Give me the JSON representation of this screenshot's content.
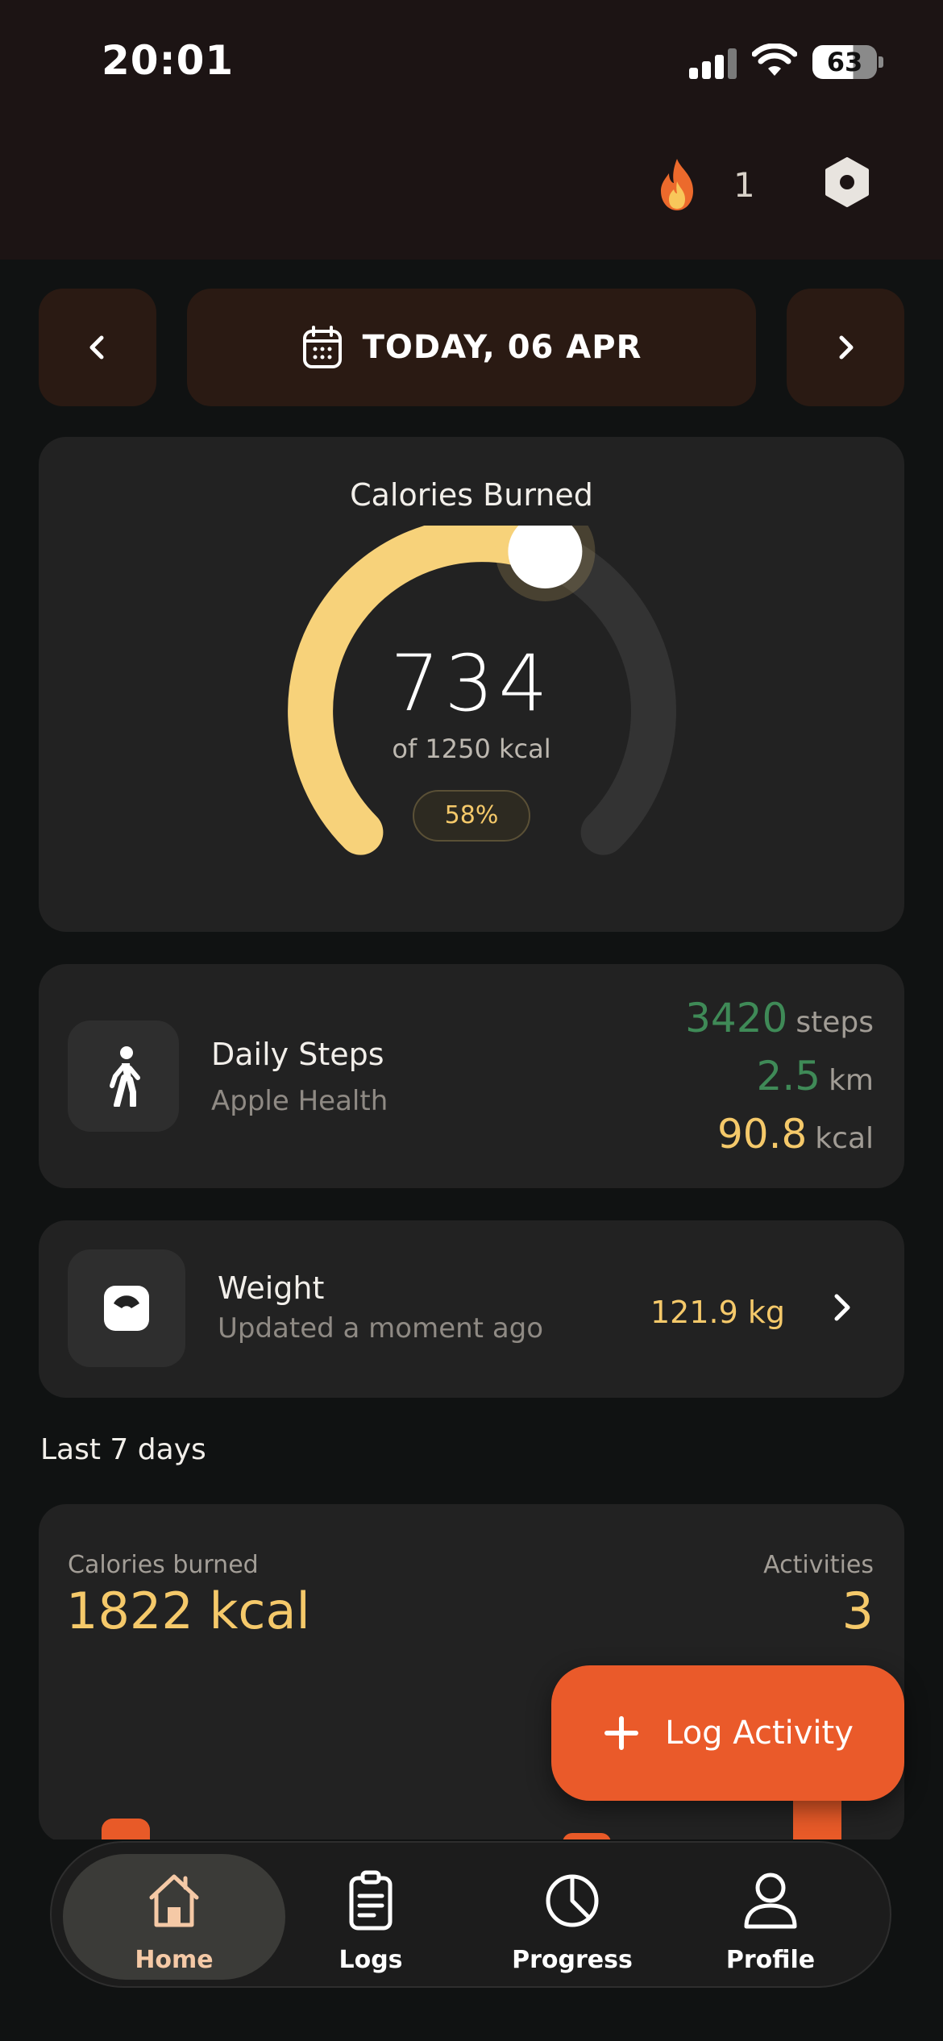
{
  "status_bar": {
    "time": "20:01",
    "battery": "63"
  },
  "header": {
    "streak_count": "1"
  },
  "date_nav": {
    "label": "TODAY, 06 APR"
  },
  "calories": {
    "title": "Calories Burned",
    "value": "734",
    "goal_text": "of 1250 kcal",
    "percent_label": "58%",
    "progress_fraction": 0.58,
    "track_color": "#333333",
    "fill_color": "#F7D27A"
  },
  "steps": {
    "title": "Daily Steps",
    "source": "Apple Health",
    "steps_value": "3420",
    "steps_unit": "steps",
    "distance_value": "2.5",
    "distance_unit": "km",
    "kcal_value": "90.8",
    "kcal_unit": "kcal"
  },
  "weight": {
    "title": "Weight",
    "subtitle": "Updated a moment ago",
    "value": "121.9 kg"
  },
  "last7": {
    "section_label": "Last 7 days",
    "calories_label": "Calories burned",
    "calories_value": "1822 kcal",
    "activities_label": "Activities",
    "activities_value": "3"
  },
  "fab": {
    "label": "Log Activity"
  },
  "tabs": [
    {
      "label": "Home",
      "icon": "home-icon",
      "active": true
    },
    {
      "label": "Logs",
      "icon": "clipboard-icon",
      "active": false
    },
    {
      "label": "Progress",
      "icon": "pie-chart-icon",
      "active": false
    },
    {
      "label": "Profile",
      "icon": "person-icon",
      "active": false
    }
  ],
  "colors": {
    "accent": "#EA5A2A",
    "gold": "#F5C96A",
    "green": "#3F8A57",
    "header_bg": "#1C1414",
    "card_bg": "#222222"
  }
}
